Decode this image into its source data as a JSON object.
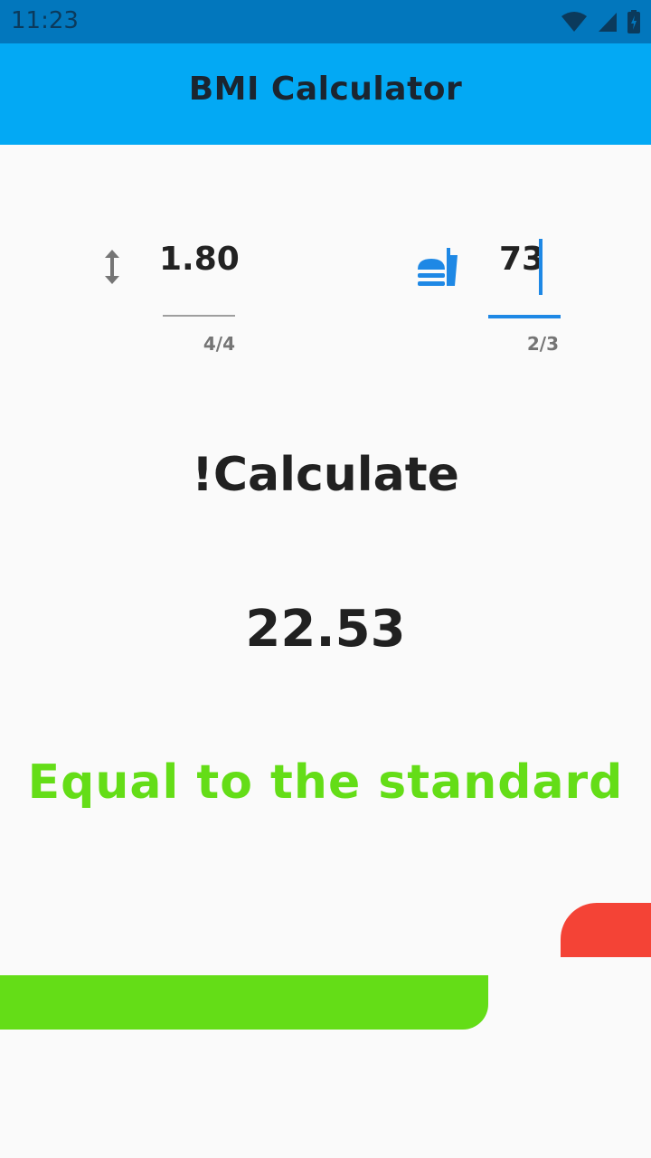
{
  "status_bar": {
    "time": "11:23",
    "icons": [
      "wifi-icon",
      "signal-icon",
      "battery-charging-icon"
    ]
  },
  "app_bar": {
    "title": "BMI Calculator",
    "color": "#03a9f4"
  },
  "height_field": {
    "icon": "height-icon",
    "value": "1.80",
    "counter": "4/4"
  },
  "weight_field": {
    "icon": "fastfood-icon",
    "value": "73",
    "counter": "2/3"
  },
  "calculate_label": "!Calculate",
  "bmi_result": "22.53",
  "status_text": "Equal to the standard",
  "colors": {
    "status_green": "#64dd17",
    "indicator_red": "#f44336",
    "accent_blue": "#1e88e5"
  },
  "indicator": {
    "green_fill": 0.75
  }
}
